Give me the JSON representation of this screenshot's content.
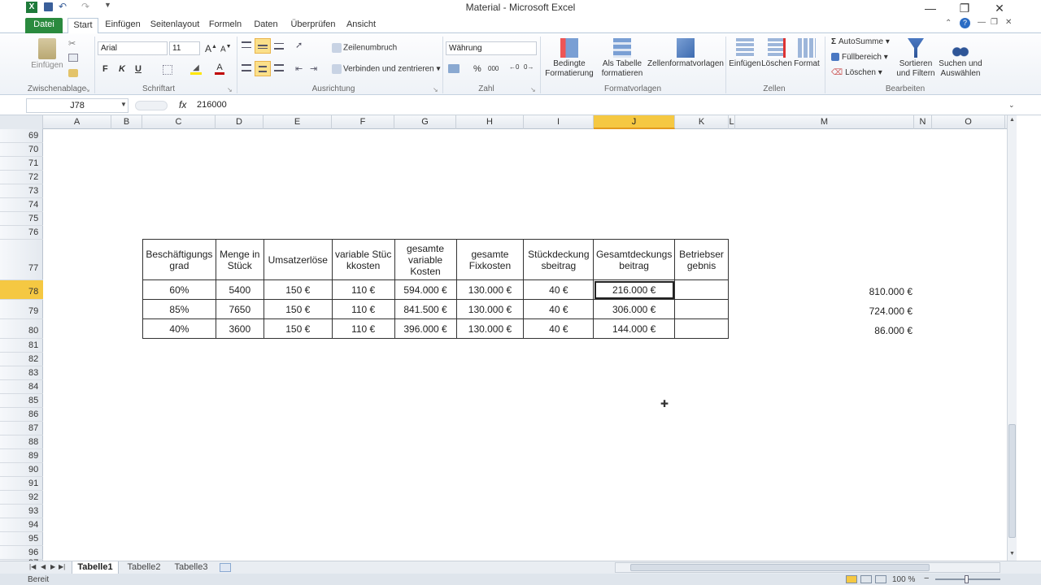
{
  "window": {
    "title": "Material - Microsoft Excel",
    "minimize": "—",
    "restore": "❐",
    "close": "✕"
  },
  "tabs": [
    "Datei",
    "Start",
    "Einfügen",
    "Seitenlayout",
    "Formeln",
    "Daten",
    "Überprüfen",
    "Ansicht"
  ],
  "ribbon": {
    "clipboard": {
      "paste": "Einfügen",
      "label": "Zwischenablage"
    },
    "font": {
      "name": "Arial",
      "size": "11",
      "bold": "F",
      "italic": "K",
      "underline": "U",
      "label": "Schriftart"
    },
    "alignment": {
      "wrap": "Zeilenumbruch",
      "merge": "Verbinden und zentrieren",
      "label": "Ausrichtung"
    },
    "number": {
      "format": "Währung",
      "label": "Zahl"
    },
    "styles": {
      "conditional": "Bedingte Formatierung",
      "as_table": "Als Tabelle formatieren",
      "cell_styles": "Zellenformatvorlagen",
      "label": "Formatvorlagen"
    },
    "cells": {
      "insert": "Einfügen",
      "delete": "Löschen",
      "format": "Format",
      "label": "Zellen"
    },
    "editing": {
      "autosum": "AutoSumme",
      "fill": "Füllbereich",
      "clear": "Löschen",
      "sort": "Sortieren und Filtern",
      "find": "Suchen und Auswählen",
      "label": "Bearbeiten"
    }
  },
  "formula_bar": {
    "name_box": "J78",
    "fx": "fx",
    "value": "216000"
  },
  "columns": [
    "A",
    "B",
    "C",
    "D",
    "E",
    "F",
    "G",
    "H",
    "I",
    "J",
    "K",
    "L",
    "M",
    "N",
    "O"
  ],
  "selected_column": "J",
  "rows_top": [
    "69",
    "70",
    "71",
    "72",
    "73",
    "74",
    "75",
    "76"
  ],
  "rows_table": [
    "77",
    "78",
    "79",
    "80"
  ],
  "rows_bottom": [
    "81",
    "82",
    "83",
    "84",
    "85",
    "86",
    "87",
    "88",
    "89",
    "90",
    "91",
    "92",
    "93",
    "94",
    "95",
    "96",
    "97"
  ],
  "selected_row": "78",
  "table": {
    "headers": [
      "Beschäftigungsgrad",
      "Menge in Stück",
      "Umsatzerlöse",
      "variable Stückkosten",
      "gesamte variable Kosten",
      "gesamte Fixkosten",
      "Stückdeckungsbeitrag",
      "Gesamtdeckungsbeitrag",
      "Betriebsergebnis"
    ],
    "rows": [
      [
        "60%",
        "5400",
        "150 €",
        "110 €",
        "594.000 €",
        "130.000 €",
        "40 €",
        "216.000 €",
        ""
      ],
      [
        "85%",
        "7650",
        "150 €",
        "110 €",
        "841.500 €",
        "130.000 €",
        "40 €",
        "306.000 €",
        ""
      ],
      [
        "40%",
        "3600",
        "150 €",
        "110 €",
        "396.000 €",
        "130.000 €",
        "40 €",
        "144.000 €",
        ""
      ]
    ]
  },
  "side_values": [
    "810.000 €",
    "724.000 €",
    "86.000 €"
  ],
  "sheet_tabs": [
    "Tabelle1",
    "Tabelle2",
    "Tabelle3"
  ],
  "active_sheet": "Tabelle1",
  "status": {
    "ready": "Bereit",
    "zoom": "100 %"
  }
}
